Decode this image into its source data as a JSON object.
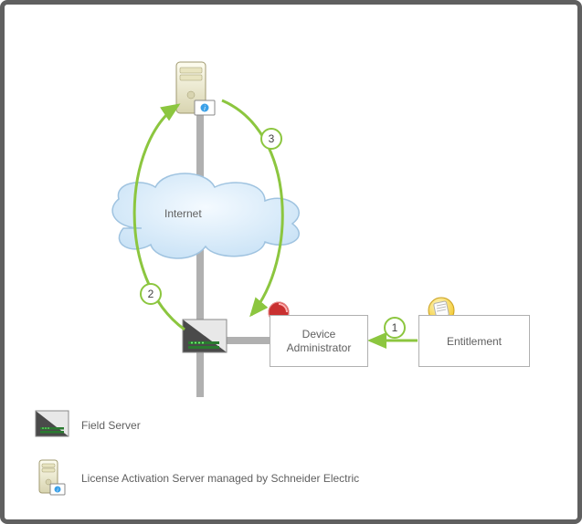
{
  "nodes": {
    "internet_label": "Internet",
    "device_admin_label": "Device\nAdministrator",
    "entitlement_label": "Entitlement"
  },
  "steps": {
    "s1": "1",
    "s2": "2",
    "s3": "3"
  },
  "legend": {
    "field_server": "Field Server",
    "license_server": "License Activation Server managed by Schneider Electric"
  }
}
